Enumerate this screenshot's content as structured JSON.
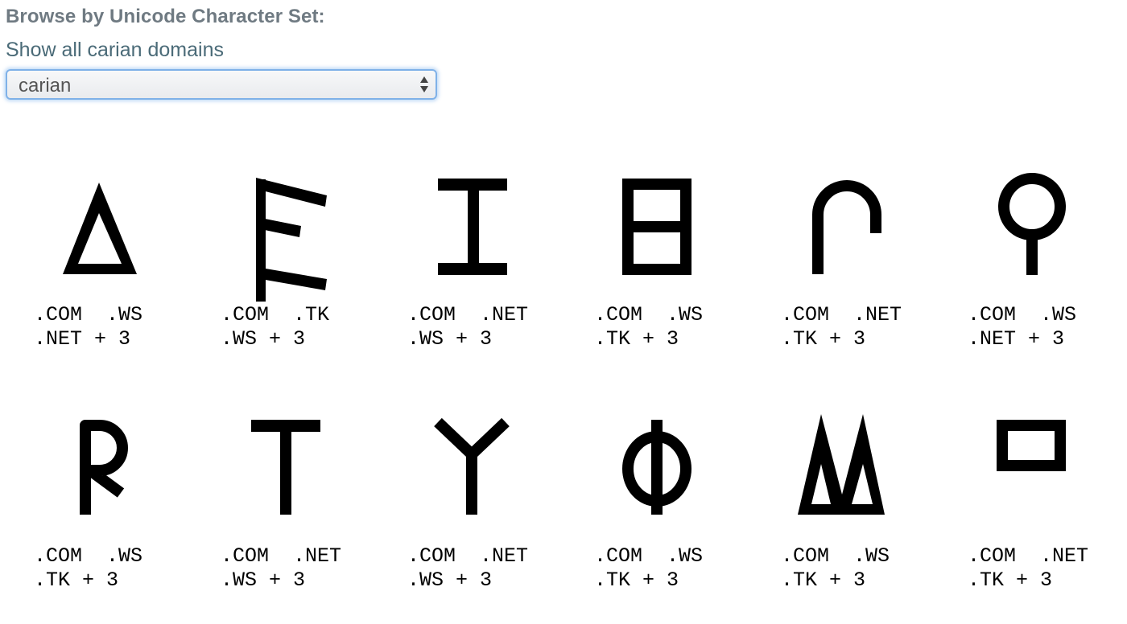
{
  "page": {
    "heading": "Browse by Unicode Character Set:",
    "show_all_link": "Show all carian domains",
    "select": {
      "value": "carian"
    }
  },
  "characters": [
    {
      "glyph": "carian-delta",
      "line1": ".COM  .WS",
      "line2": ".NET + 3"
    },
    {
      "glyph": "carian-e",
      "line1": ".COM  .TK",
      "line2": ".WS + 3"
    },
    {
      "glyph": "carian-i",
      "line1": ".COM  .NET",
      "line2": ".WS + 3"
    },
    {
      "glyph": "carian-box-bar",
      "line1": ".COM  .WS",
      "line2": ".TK + 3"
    },
    {
      "glyph": "carian-arch",
      "line1": ".COM  .NET",
      "line2": ".TK + 3"
    },
    {
      "glyph": "carian-ring-stem",
      "line1": ".COM  .WS",
      "line2": ".NET + 3"
    },
    {
      "glyph": "carian-r",
      "line1": ".COM  .WS",
      "line2": ".TK + 3"
    },
    {
      "glyph": "carian-t",
      "line1": ".COM  .NET",
      "line2": ".WS + 3"
    },
    {
      "glyph": "carian-y",
      "line1": ".COM  .NET",
      "line2": ".WS + 3"
    },
    {
      "glyph": "carian-phi",
      "line1": ".COM  .WS",
      "line2": ".TK + 3"
    },
    {
      "glyph": "carian-double-peak",
      "line1": ".COM  .WS",
      "line2": ".TK + 3"
    },
    {
      "glyph": "carian-rectangle",
      "line1": ".COM  .NET",
      "line2": ".TK + 3"
    }
  ]
}
